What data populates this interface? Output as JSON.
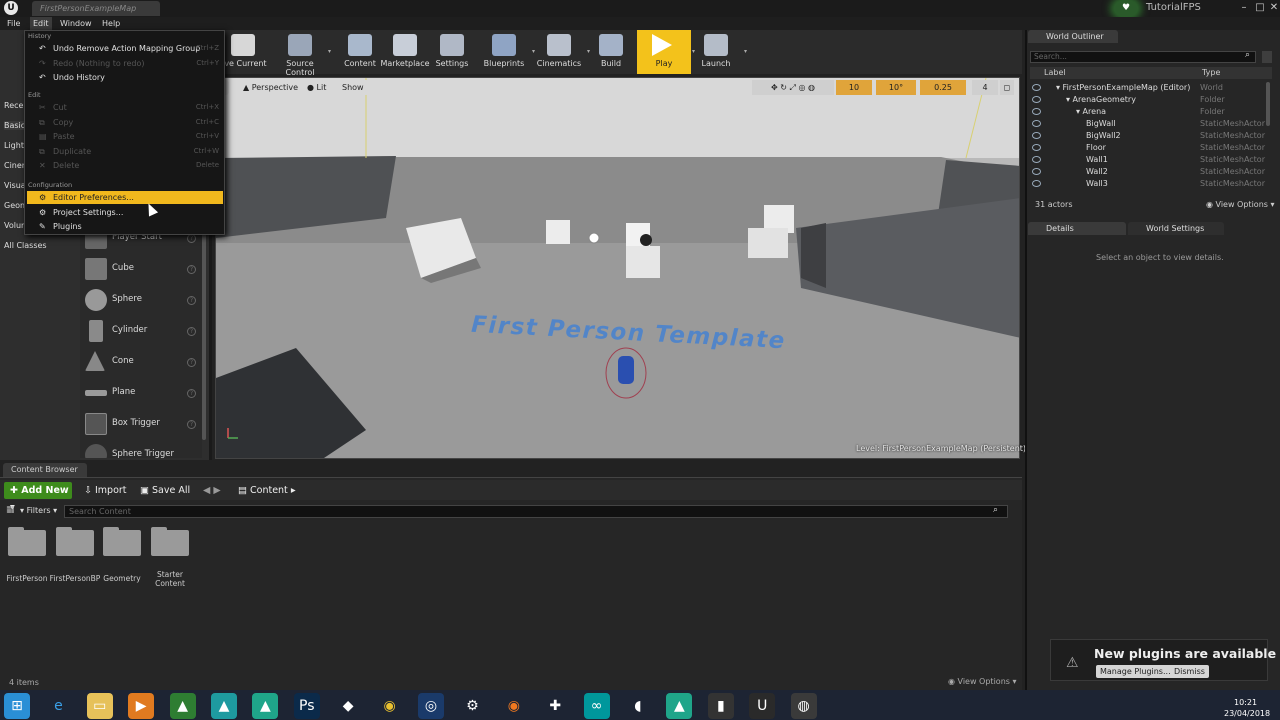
{
  "title_bar": {
    "map_tab": "FirstPersonExampleMap",
    "project_name": "TutorialFPS"
  },
  "menu_bar": [
    "File",
    "Edit",
    "Window",
    "Help"
  ],
  "modes_panel": {
    "tabs": [
      "Rece",
      "Basic",
      "Light",
      "Cinem",
      "Visua",
      "Geom",
      "Volum"
    ],
    "all_classes": "All Classes",
    "place_items": [
      "Player Start",
      "Cube",
      "Sphere",
      "Cylinder",
      "Cone",
      "Plane",
      "Box Trigger",
      "Sphere Trigger"
    ]
  },
  "toolbar": {
    "buttons": [
      {
        "label": "ave Current",
        "icon": "save-icon",
        "color": "#d7d7d7"
      },
      {
        "label": "Source Control",
        "icon": "source-control-icon",
        "color": "#9aa6b8"
      },
      {
        "label": "Content",
        "icon": "content-icon",
        "color": "#a9b8cc"
      },
      {
        "label": "Marketplace",
        "icon": "marketplace-icon",
        "color": "#c8ced8"
      },
      {
        "label": "Settings",
        "icon": "settings-icon",
        "color": "#b0b8c6"
      },
      {
        "label": "Blueprints",
        "icon": "blueprints-icon",
        "color": "#8fa4c4"
      },
      {
        "label": "Cinematics",
        "icon": "cinematics-icon",
        "color": "#b9c0cc"
      },
      {
        "label": "Build",
        "icon": "build-icon",
        "color": "#a4b2c8"
      },
      {
        "label": "Play",
        "icon": "play-icon",
        "color": "#f3c21b"
      },
      {
        "label": "Launch",
        "icon": "launch-icon",
        "color": "#b4bcc8"
      }
    ]
  },
  "viewport": {
    "perspective": "Perspective",
    "lit": "Lit",
    "show": "Show",
    "grid_snap": "10",
    "rot_snap": "10°",
    "scale_snap": "0.25",
    "cam_speed": "4",
    "template_text": "First Person Template",
    "level_text": "Level:  FirstPersonExampleMap (Persistent)"
  },
  "edit_menu": {
    "history_label": "History",
    "history_items": [
      {
        "label": "Undo Remove Action Mapping Group",
        "shortcut": "Ctrl+Z",
        "disabled": false
      },
      {
        "label": "Redo (Nothing to redo)",
        "shortcut": "Ctrl+Y",
        "disabled": true
      },
      {
        "label": "Undo History",
        "shortcut": "",
        "disabled": false
      }
    ],
    "edit_label": "Edit",
    "edit_items": [
      {
        "label": "Cut",
        "shortcut": "Ctrl+X"
      },
      {
        "label": "Copy",
        "shortcut": "Ctrl+C"
      },
      {
        "label": "Paste",
        "shortcut": "Ctrl+V"
      },
      {
        "label": "Duplicate",
        "shortcut": "Ctrl+W"
      },
      {
        "label": "Delete",
        "shortcut": "Delete"
      }
    ],
    "config_label": "Configuration",
    "config_items": [
      "Editor Preferences...",
      "Project Settings...",
      "Plugins"
    ]
  },
  "content_browser": {
    "tab": "Content Browser",
    "add_new": "Add New",
    "import": "Import",
    "save_all": "Save All",
    "path": "Content",
    "filters": "Filters",
    "search_placeholder": "Search Content",
    "folders": [
      "FirstPerson",
      "FirstPersonBP",
      "Geometry",
      "Starter Content"
    ],
    "item_count": "4 items",
    "view_options": "View Options"
  },
  "world_outliner": {
    "tab": "World Outliner",
    "search_placeholder": "Search...",
    "col_label": "Label",
    "col_type": "Type",
    "rows": [
      {
        "label": "FirstPersonExampleMap (Editor)",
        "type": "World",
        "indent": 0
      },
      {
        "label": "ArenaGeometry",
        "type": "Folder",
        "indent": 1
      },
      {
        "label": "Arena",
        "type": "Folder",
        "indent": 2
      },
      {
        "label": "BigWall",
        "type": "StaticMeshActor",
        "indent": 3
      },
      {
        "label": "BigWall2",
        "type": "StaticMeshActor",
        "indent": 3
      },
      {
        "label": "Floor",
        "type": "StaticMeshActor",
        "indent": 3
      },
      {
        "label": "Wall1",
        "type": "StaticMeshActor",
        "indent": 3
      },
      {
        "label": "Wall2",
        "type": "StaticMeshActor",
        "indent": 3
      },
      {
        "label": "Wall3",
        "type": "StaticMeshActor",
        "indent": 3
      }
    ],
    "actor_count": "31 actors",
    "view_options": "View Options"
  },
  "details": {
    "tab": "Details",
    "world_settings_tab": "World Settings",
    "hint": "Select an object to view details."
  },
  "notification": {
    "title": "New plugins are available",
    "manage": "Manage Plugins...",
    "dismiss": "Dismiss"
  },
  "taskbar": {
    "time": "10:21",
    "date": "23/04/2018"
  }
}
